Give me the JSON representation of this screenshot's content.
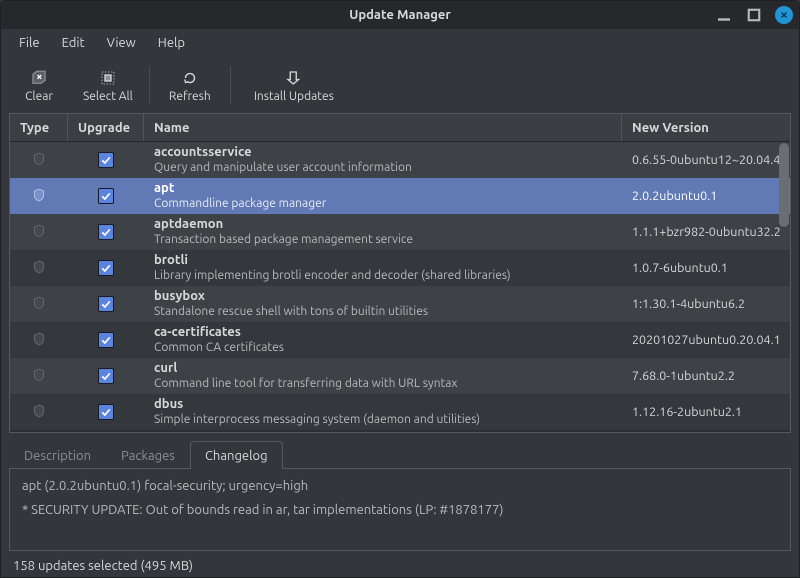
{
  "window": {
    "title": "Update Manager"
  },
  "menubar": {
    "items": [
      "File",
      "Edit",
      "View",
      "Help"
    ]
  },
  "toolbar": {
    "clear": "Clear",
    "select_all": "Select All",
    "refresh": "Refresh",
    "install": "Install Updates"
  },
  "table": {
    "headers": {
      "type": "Type",
      "upgrade": "Upgrade",
      "name": "Name",
      "version": "New Version"
    },
    "rows": [
      {
        "name": "accountsservice",
        "desc": "Query and manipulate user account information",
        "version": "0.6.55-0ubuntu12~20.04.4",
        "checked": true,
        "selected": false
      },
      {
        "name": "apt",
        "desc": "Commandline package manager",
        "version": "2.0.2ubuntu0.1",
        "checked": true,
        "selected": true
      },
      {
        "name": "aptdaemon",
        "desc": "Transaction based package management service",
        "version": "1.1.1+bzr982-0ubuntu32.2",
        "checked": true,
        "selected": false
      },
      {
        "name": "brotli",
        "desc": "Library implementing brotli encoder and decoder (shared libraries)",
        "version": "1.0.7-6ubuntu0.1",
        "checked": true,
        "selected": false
      },
      {
        "name": "busybox",
        "desc": "Standalone rescue shell with tons of builtin utilities",
        "version": "1:1.30.1-4ubuntu6.2",
        "checked": true,
        "selected": false
      },
      {
        "name": "ca-certificates",
        "desc": "Common CA certificates",
        "version": "20201027ubuntu0.20.04.1",
        "checked": true,
        "selected": false
      },
      {
        "name": "curl",
        "desc": "Command line tool for transferring data with URL syntax",
        "version": "7.68.0-1ubuntu2.2",
        "checked": true,
        "selected": false
      },
      {
        "name": "dbus",
        "desc": "Simple interprocess messaging system (daemon and utilities)",
        "version": "1.12.16-2ubuntu2.1",
        "checked": true,
        "selected": false
      }
    ]
  },
  "details": {
    "tabs": {
      "description": "Description",
      "packages": "Packages",
      "changelog": "Changelog"
    },
    "changelog": {
      "line1": "apt (2.0.2ubuntu0.1) focal-security; urgency=high",
      "line2": "  * SECURITY UPDATE: Out of bounds read in ar, tar implementations (LP: #1878177)"
    }
  },
  "statusbar": {
    "text": "158 updates selected (495 MB)"
  }
}
